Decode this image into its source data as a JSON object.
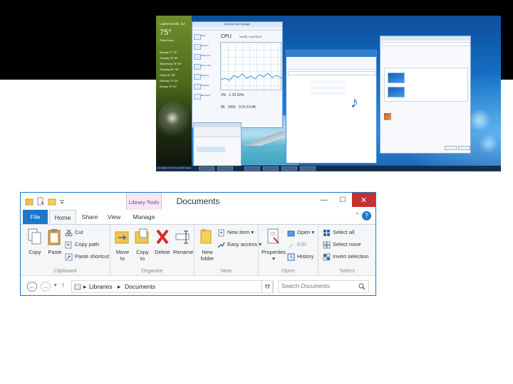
{
  "desktop": {
    "weather": {
      "city": "Lawrenceville, GA",
      "temperature": "75°",
      "condition": "Partly Sunny",
      "forecast": [
        "Monday 77° 67°",
        "Tuesday 78° 66°",
        "Wednesday 78° 65°",
        "Thursday 80° 66°",
        "Friday 81° 66°",
        "Saturday 79° 66°",
        "Sunday 76° 63°"
      ]
    },
    "task_manager": {
      "title": "Windows Task Manager",
      "heading": "CPU",
      "processor": "Intel(R) Core(TM) i5",
      "sidebar": [
        "CPU",
        "Memory",
        "Disk 0 (C:)",
        "Disk 1 (D:)",
        "Ethernet",
        "Wireless",
        "Bluetooth"
      ],
      "stats": [
        "3%",
        "1.29 GHz",
        "85",
        "1065"
      ],
      "uptime": "0:01:13:48"
    },
    "taskbar_note": "Last updated: 2/17 Screen Update Helper"
  },
  "explorer": {
    "title": "Documents",
    "contextual_tab": "Library Tools",
    "tabs": [
      "File",
      "Home",
      "Share",
      "View",
      "Manage"
    ],
    "window_controls": {
      "minimize": "—",
      "maximize": "☐",
      "close": "✕"
    },
    "help_caret": "⌃",
    "help": "?",
    "ribbon": {
      "clipboard": {
        "group": "Clipboard",
        "copy": "Copy",
        "paste": "Paste",
        "cut": "Cut",
        "copy_path": "Copy path",
        "paste_shortcut": "Paste shortcut"
      },
      "organize": {
        "group": "Organize",
        "move_to": [
          "Move",
          "to"
        ],
        "copy_to": [
          "Copy",
          "to"
        ],
        "delete": "Delete",
        "rename": "Rename"
      },
      "new": {
        "group": "New",
        "new_folder": [
          "New",
          "folder"
        ],
        "new_item": "New item",
        "easy_access": "Easy access"
      },
      "open": {
        "group": "Open",
        "properties": "Properties",
        "open": "Open",
        "edit": "Edit",
        "history": "History"
      },
      "select": {
        "group": "Select",
        "select_all": "Select all",
        "select_none": "Select none",
        "invert": "Invert selection"
      }
    },
    "address": {
      "back": "←",
      "forward": "→",
      "up": "↑",
      "path": [
        "Libraries",
        "Documents"
      ],
      "refresh": "↻",
      "search_placeholder": "Search Documents"
    }
  },
  "colors": {
    "accent": "#1979ca",
    "context_tab": "#f7e6f5",
    "close": "#c7302c"
  }
}
